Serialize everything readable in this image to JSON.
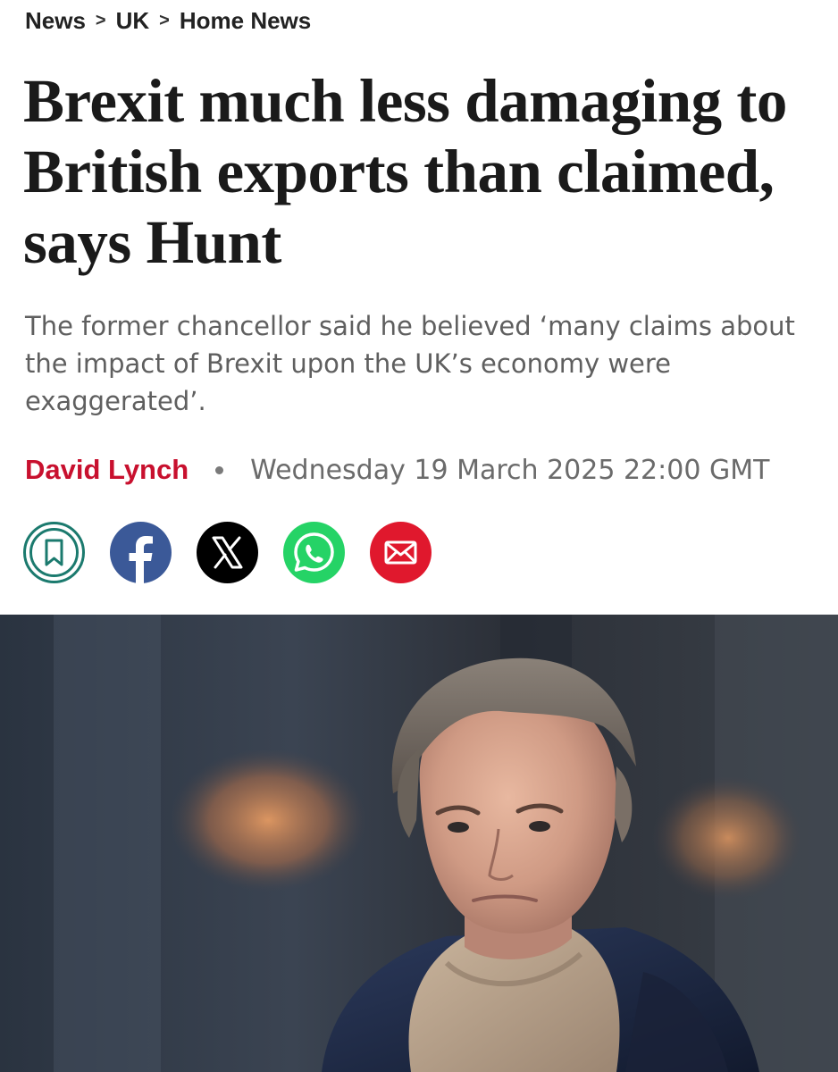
{
  "breadcrumb": {
    "items": [
      "News",
      "UK",
      "Home News"
    ],
    "separator": ">"
  },
  "article": {
    "headline": "Brexit much less damaging to British exports than claimed, says Hunt",
    "standfirst": "The former chancellor said he believed ‘many claims about the impact of Brexit upon the UK’s economy were exaggerated’.",
    "author": "David Lynch",
    "date": "Wednesday 19 March 2025 22:00 GMT"
  },
  "share": {
    "buttons": [
      {
        "name": "bookmark-button",
        "icon": "bookmark-icon",
        "color": "#1b7a6e"
      },
      {
        "name": "facebook-share-button",
        "icon": "facebook-icon",
        "color": "#3b5998"
      },
      {
        "name": "x-share-button",
        "icon": "x-icon",
        "color": "#000000"
      },
      {
        "name": "whatsapp-share-button",
        "icon": "whatsapp-icon",
        "color": "#25d366"
      },
      {
        "name": "email-share-button",
        "icon": "envelope-icon",
        "color": "#e0182d"
      }
    ]
  },
  "colors": {
    "author": "#c8102e",
    "standfirst": "#5f5f5f",
    "headline": "#1a1a1a"
  },
  "hero_image": {
    "subject": "photo-portrait"
  }
}
